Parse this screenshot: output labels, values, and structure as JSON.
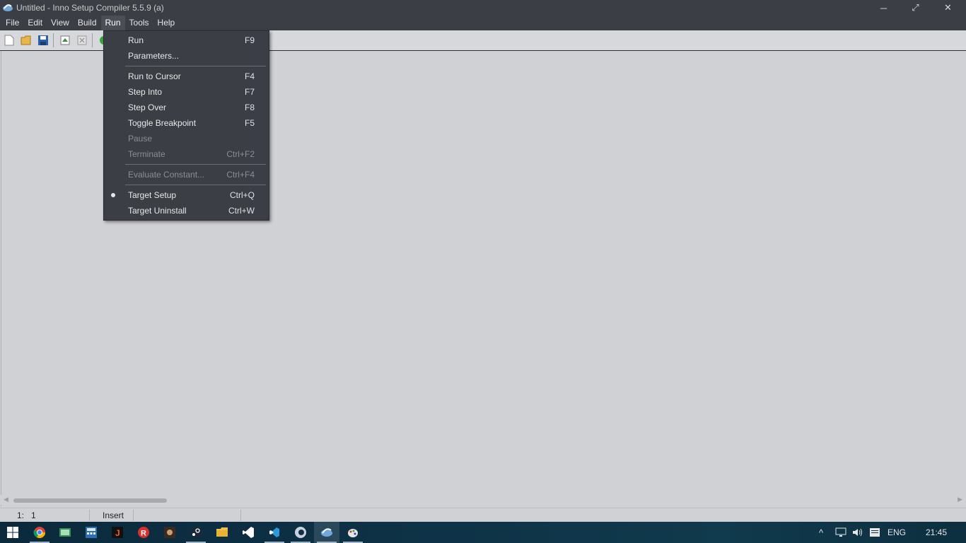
{
  "window": {
    "title": "Untitled - Inno Setup Compiler 5.5.9 (a)",
    "controls": {
      "minimize": "─",
      "restore": "⤢",
      "close": "✕"
    }
  },
  "menubar": {
    "items": [
      {
        "label": "File"
      },
      {
        "label": "Edit"
      },
      {
        "label": "View"
      },
      {
        "label": "Build"
      },
      {
        "label": "Run"
      },
      {
        "label": "Tools"
      },
      {
        "label": "Help"
      }
    ],
    "active": "Run"
  },
  "toolbar": {
    "buttons": [
      "new-icon",
      "open-icon",
      "save-icon",
      "compile-icon",
      "stop-compile-icon",
      "run-icon"
    ]
  },
  "run_menu": {
    "items": [
      {
        "label": "Run",
        "shortcut": "F9"
      },
      {
        "label": "Parameters...",
        "shortcut": ""
      },
      {
        "label": "Run to Cursor",
        "shortcut": "F4"
      },
      {
        "label": "Step Into",
        "shortcut": "F7"
      },
      {
        "label": "Step Over",
        "shortcut": "F8"
      },
      {
        "label": "Toggle Breakpoint",
        "shortcut": "F5"
      },
      {
        "label": "Pause",
        "shortcut": "",
        "disabled": true
      },
      {
        "label": "Terminate",
        "shortcut": "Ctrl+F2",
        "disabled": true
      },
      {
        "label": "Evaluate Constant...",
        "shortcut": "Ctrl+F4",
        "disabled": true
      },
      {
        "label": "Target Setup",
        "shortcut": "Ctrl+Q",
        "checked": true
      },
      {
        "label": "Target Uninstall",
        "shortcut": "Ctrl+W"
      }
    ]
  },
  "statusbar": {
    "position": "1:   1",
    "mode": "Insert"
  },
  "taskbar": {
    "apps": [
      "start-icon",
      "chrome-icon",
      "app-green-icon",
      "calculator-icon",
      "jetbrains-icon",
      "red-r-icon",
      "game-icon",
      "steam-icon",
      "file-explorer-icon",
      "visual-studio-icon",
      "vscode-icon",
      "browser-icon",
      "inno-setup-icon",
      "paint-icon"
    ],
    "tray": {
      "chevron": "^",
      "language": "ENG",
      "time": "21:45"
    }
  }
}
